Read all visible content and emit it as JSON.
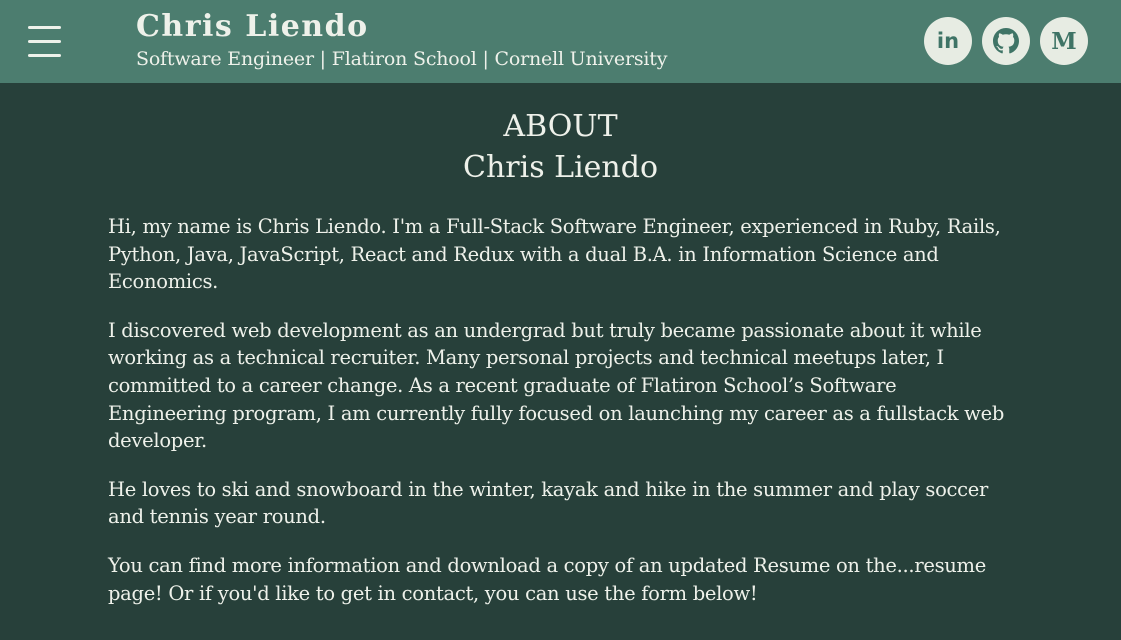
{
  "header": {
    "menu_icon": "hamburger-menu-icon",
    "name": "Chris Liendo",
    "subtitle": "Software Engineer | Flatiron School | Cornell University",
    "social": [
      {
        "icon": "linkedin-icon",
        "glyph": "in"
      },
      {
        "icon": "github-icon",
        "glyph": "github"
      },
      {
        "icon": "medium-icon",
        "glyph": "M"
      }
    ]
  },
  "about": {
    "heading": "ABOUT",
    "name": "Chris Liendo",
    "paragraphs": [
      "Hi, my name is Chris Liendo. I'm a Full-Stack Software Engineer, experienced in Ruby, Rails, Python, Java, JavaScript, React and Redux with a dual B.A. in Information Science and Economics.",
      "I discovered web development as an undergrad but truly became passionate about it while working as a technical recruiter. Many personal projects and technical meetups later, I committed to a career change. As a recent graduate of Flatiron School’s Software Engineering program, I am currently fully focused on launching my career as a fullstack web developer.",
      "He loves to ski and snowboard in the winter, kayak and hike in the summer and play soccer and tennis year round.",
      "You can find more information and download a copy of an updated Resume on the...resume page! Or if you'd like to get in contact, you can use the form below!"
    ]
  },
  "colors": {
    "header_bg": "#4c7d6f",
    "page_bg": "#27403a",
    "text": "#eef1ea",
    "icon_bg": "#e7ece3",
    "icon_fg": "#3f7466"
  }
}
